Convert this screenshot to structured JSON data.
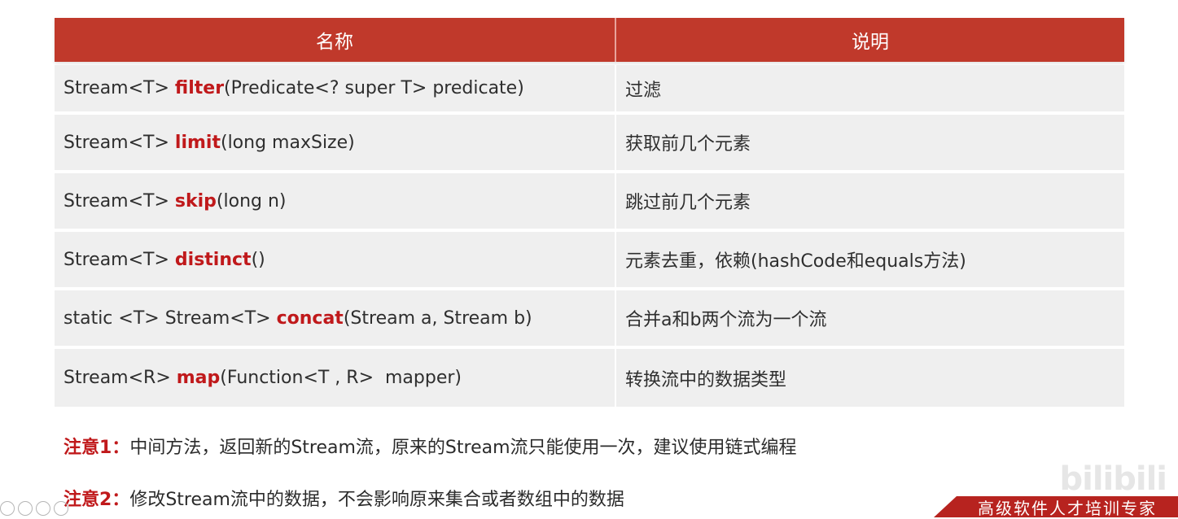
{
  "table": {
    "headers": [
      "名称",
      "说明"
    ],
    "rows": [
      {
        "prefix": "Stream<T> ",
        "method": "filter",
        "suffix": "(Predicate<? super T> predicate)",
        "desc": "过滤"
      },
      {
        "prefix": "Stream<T> ",
        "method": "limit",
        "suffix": "(long maxSize)",
        "desc": "获取前几个元素"
      },
      {
        "prefix": "Stream<T> ",
        "method": "skip",
        "suffix": "(long n)",
        "desc": "跳过前几个元素"
      },
      {
        "prefix": "Stream<T> ",
        "method": "distinct",
        "suffix": "()",
        "desc": "元素去重，依赖(hashCode和equals方法)"
      },
      {
        "prefix": "static <T> Stream<T> ",
        "method": "concat",
        "suffix": "(Stream a, Stream b)",
        "desc": "合并a和b两个流为一个流"
      },
      {
        "prefix": "Stream<R> ",
        "method": "map",
        "suffix": "(Function<T , R>  mapper)",
        "desc": "转换流中的数据类型"
      }
    ]
  },
  "notes": [
    {
      "label": "注意1：",
      "text": "中间方法，返回新的Stream流，原来的Stream流只能使用一次，建议使用链式编程"
    },
    {
      "label": "注意2：",
      "text": "修改Stream流中的数据，不会影响原来集合或者数组中的数据"
    }
  ],
  "footer": {
    "slogan": "高级软件人才培训专家"
  },
  "watermark": {
    "text": "bilibili"
  },
  "colors": {
    "header_bg": "#c0392b",
    "row_bg": "#efefef",
    "accent_red": "#c0191b"
  }
}
